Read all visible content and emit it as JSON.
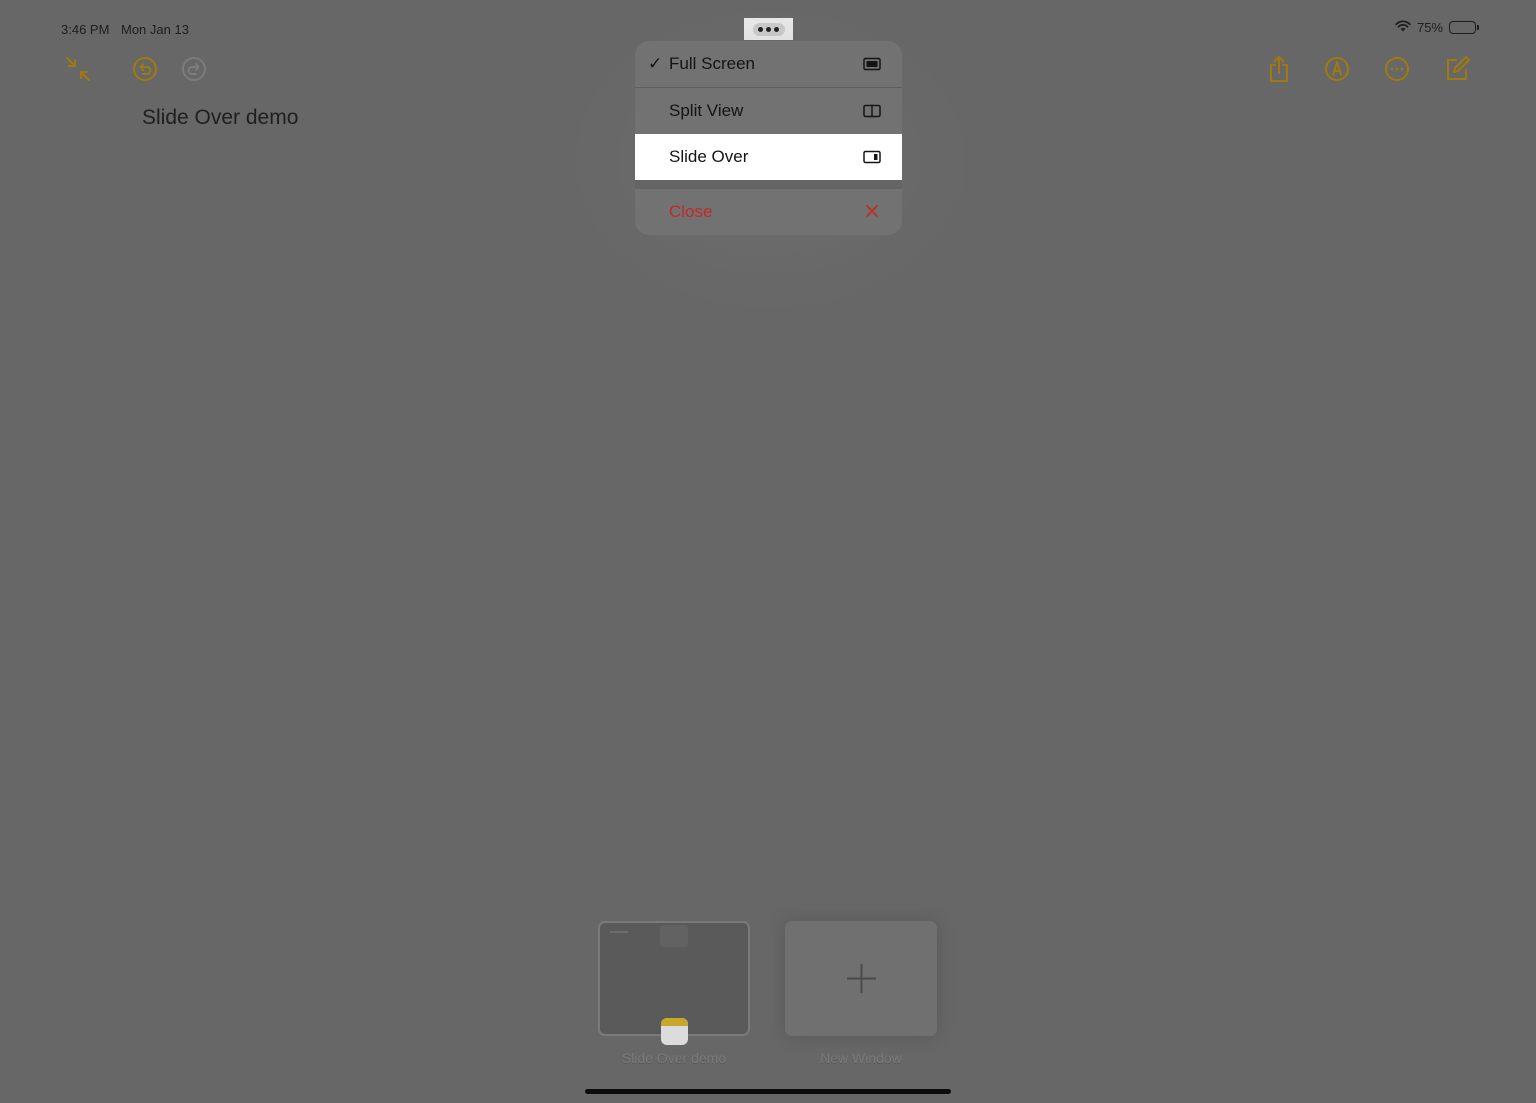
{
  "status_bar": {
    "time": "3:46 PM",
    "date": "Mon Jan 13",
    "battery_percent": "75%",
    "battery_level": 0.75,
    "wifi_icon": "wifi-icon"
  },
  "toolbar": {
    "left_icons": [
      "collapse-arrows-icon",
      "undo-icon",
      "redo-icon"
    ],
    "right_icons": [
      "share-icon",
      "markup-pen-icon",
      "more-ellipsis-icon",
      "compose-icon"
    ],
    "accent_color": "#a07a10"
  },
  "note": {
    "title": "Slide Over demo"
  },
  "multitask_menu": {
    "items": [
      {
        "label": "Full Screen",
        "checked": true,
        "icon": "full-screen-icon"
      },
      {
        "label": "Split View",
        "checked": false,
        "icon": "split-view-icon"
      },
      {
        "label": "Slide Over",
        "checked": false,
        "highlighted": true,
        "icon": "slide-over-icon"
      },
      {
        "label": "Close",
        "checked": false,
        "destructive": true,
        "icon": "close-x-icon"
      }
    ],
    "check_glyph": "✓",
    "destructive_color": "#c22a25"
  },
  "switcher": {
    "windows": [
      {
        "label": "Slide Over demo",
        "app_icon": "notes-app-icon"
      },
      {
        "label": "New Window",
        "icon": "plus-icon"
      }
    ]
  }
}
